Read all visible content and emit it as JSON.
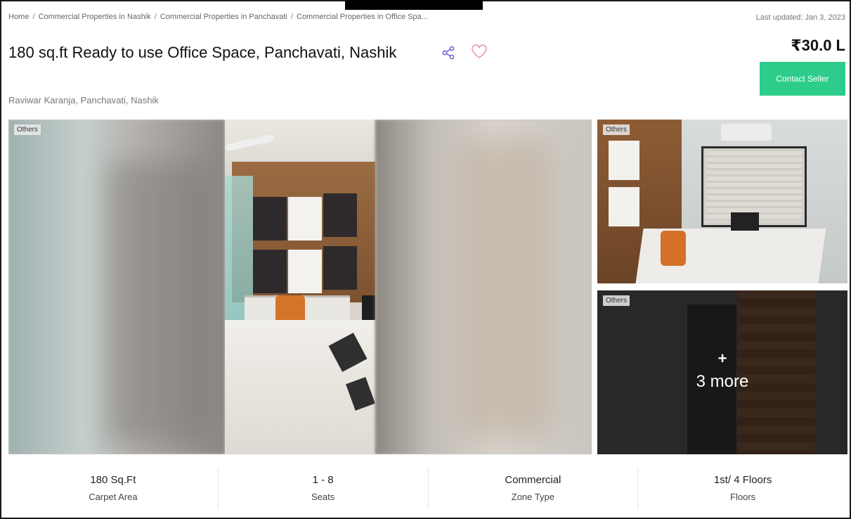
{
  "breadcrumb": [
    {
      "label": "Home"
    },
    {
      "label": "Commercial Properties in Nashik"
    },
    {
      "label": "Commercial Properties in Panchavati"
    },
    {
      "label": "Commercial Properties in Office Spa..."
    }
  ],
  "last_updated": "Last updated: Jan 3, 2023",
  "listing": {
    "title": "180 sq.ft Ready to use Office Space, Panchavati, Nashik",
    "address": "Raviwar Karanja, Panchavati, Nashik",
    "price": "₹30.0 L",
    "contact_label": "Contact Seller"
  },
  "icons": {
    "share": "share-icon",
    "favorite": "heart-icon"
  },
  "colors": {
    "accent": "#2ecc8a"
  },
  "gallery": {
    "main_tag": "Others",
    "thumb1_tag": "Others",
    "thumb2_tag": "Others",
    "more_plus": "+",
    "more_label": "3 more"
  },
  "stats": [
    {
      "value": "180 Sq.Ft",
      "label": "Carpet Area"
    },
    {
      "value": "1 - 8",
      "label": "Seats"
    },
    {
      "value": "Commercial",
      "label": "Zone Type"
    },
    {
      "value": "1st/ 4 Floors",
      "label": "Floors"
    }
  ]
}
